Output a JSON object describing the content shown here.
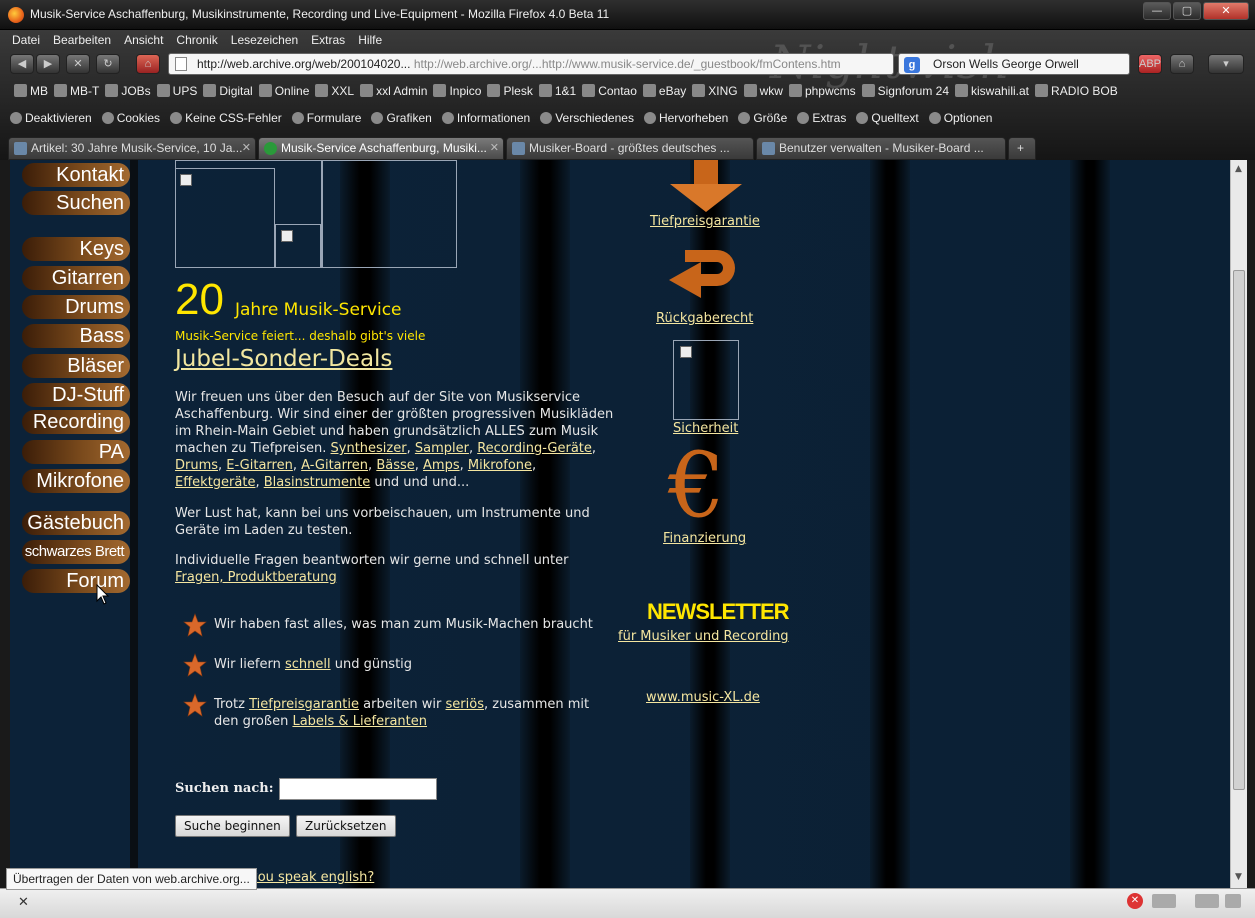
{
  "window": {
    "title": "Musik-Service Aschaffenburg, Musikinstrumente, Recording und Live-Equipment - Mozilla Firefox 4.0 Beta 11",
    "buttons": [
      "—",
      "▢",
      "✕"
    ]
  },
  "menubar": [
    "Datei",
    "Bearbeiten",
    "Ansicht",
    "Chronik",
    "Lesezeichen",
    "Extras",
    "Hilfe"
  ],
  "navbar": {
    "url_main": "http://web.archive.org/web/200104020...",
    "url_gray": "  http://web.archive.org/...http://www.musik-service.de/_guestbook/fmContens.htm",
    "search_value": "Orson Wells George Orwell",
    "search_engine_icon": "g-icon"
  },
  "bookmarks": [
    "MB",
    "MB-T",
    "JOBs",
    "UPS",
    "Digital",
    "Online",
    "XXL",
    "xxl Admin",
    "Inpico",
    "Plesk",
    "1&1",
    "Contao",
    "eBay",
    "XING",
    "wkw",
    "phpwcms",
    "Signforum 24",
    "kiswahili.at",
    "RADIO BOB"
  ],
  "devbar": [
    "Deaktivieren",
    "Cookies",
    "Keine CSS-Fehler",
    "Formulare",
    "Grafiken",
    "Informationen",
    "Verschiedenes",
    "Hervorheben",
    "Größe",
    "Extras",
    "Quelltext",
    "Optionen"
  ],
  "tabs": [
    {
      "label": "Artikel: 30 Jahre Musik-Service, 10 Ja...",
      "active": false
    },
    {
      "label": "Musik-Service Aschaffenburg, Musiki...",
      "active": true
    },
    {
      "label": "Musiker-Board - größtes deutsches ...",
      "active": false
    },
    {
      "label": "Benutzer verwalten - Musiker-Board ...",
      "active": false
    }
  ],
  "left_nav": [
    "Kontakt",
    "Suchen",
    "Keys",
    "Gitarren",
    "Drums",
    "Bass",
    "Bläser",
    "DJ-Stuff",
    "Recording",
    "PA",
    "Mikrofone",
    "Gästebuch",
    "schwarzes Brett",
    "Forum"
  ],
  "content": {
    "big_number": "20",
    "jahre": "Jahre Musik-Service",
    "feiert": "Musik-Service feiert... deshalb gibt's viele",
    "jubel": "Jubel-Sonder-Deals",
    "intro_1": "Wir freuen uns über den Besuch auf der Site von Musikservice Aschaffenburg. Wir sind einer der größten progressiven Musikläden im Rhein-Main Gebiet und haben grundsätzlich ALLES zum Musik machen zu Tiefpreisen. ",
    "intro_links": [
      "Synthesizer",
      "Sampler",
      "Recording-Geräte",
      "Drums",
      "E-Gitarren",
      "A-Gitarren",
      "Bässe",
      "Amps",
      "Mikrofone",
      "Effektgeräte",
      "Blasinstrumente"
    ],
    "intro_tail": " und und und...",
    "visit_text": "Wer Lust hat, kann  bei uns vorbeischauen, um Instrumente und Geräte im Laden zu testen.",
    "questions_text": "Individuelle Fragen beantworten wir gerne und schnell unter",
    "questions_link": "Fragen, Produktberatung",
    "bullet_1": "Wir haben fast alles, was man zum Musik-Machen braucht",
    "bullet_2_pre": "Wir liefern ",
    "bullet_2_link": "schnell",
    "bullet_2_post": " und günstig",
    "bullet_3_pre": "Trotz ",
    "bullet_3_link1": "Tiefpreisgarantie",
    "bullet_3_mid": " arbeiten wir ",
    "bullet_3_link2": "seriös",
    "bullet_3_mid2": ", zusammen mit den großen ",
    "bullet_3_link3": "Labels & Lieferanten",
    "search_label": "Suchen nach:",
    "search_button": "Suche beginnen",
    "reset_button": "Zurücksetzen",
    "english_link": "you speak english?"
  },
  "right_col": {
    "tiefpreis": "Tiefpreisgarantie",
    "rueckgabe": "Rückgaberecht",
    "sicherheit": "Sicherheit",
    "finanzierung": "Finanzierung",
    "euro_symbol": "€",
    "newsletter": "NEWSLETTER",
    "newsletter_link": "für Musiker und Recording",
    "music_xl": "www.music-XL.de"
  },
  "status": {
    "tooltip": "Übertragen der Daten von web.archive.org...",
    "close": "✕"
  },
  "colors": {
    "page_bg": "#0c2238",
    "yellow": "#ffe600",
    "link": "#f5e6a0",
    "orange": "#c8651a"
  }
}
